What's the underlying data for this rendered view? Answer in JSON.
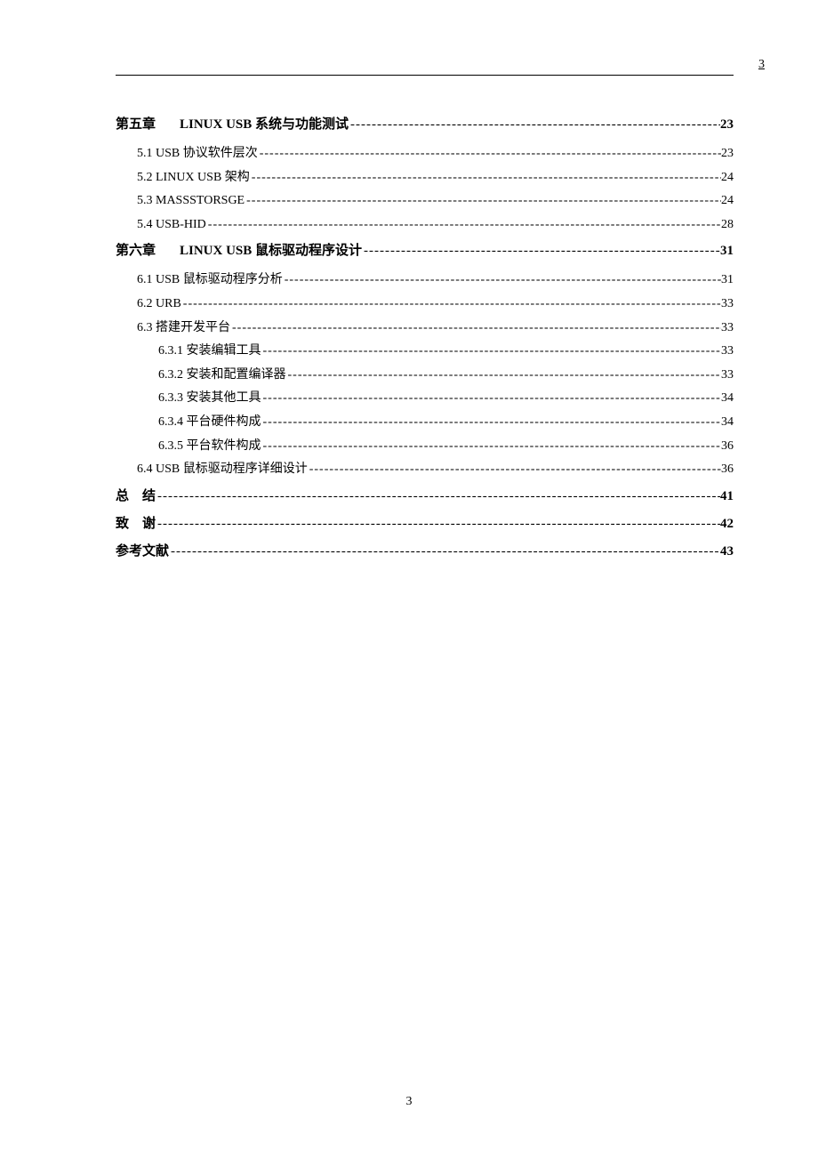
{
  "header": {
    "page_number_top": "3"
  },
  "footer": {
    "page_number_bottom": "3"
  },
  "leader_dots": "----------------------------------------------------------------------------------------------------------------------------------------------------------------------------------------------------",
  "toc": [
    {
      "type": "chapter",
      "num": "第五章",
      "title": "LINUX USB 系统与功能测试",
      "page": "23"
    },
    {
      "type": "sub",
      "title": "5.1 USB 协议软件层次",
      "page": "23"
    },
    {
      "type": "sub",
      "title": "5.2 LINUX USB 架构",
      "page": "24",
      "smallcaps": true
    },
    {
      "type": "sub",
      "title": "5.3 MASSSTORSGE",
      "page": "24",
      "smallcaps": true
    },
    {
      "type": "sub",
      "title": "5.4 USB-HID",
      "page": "28"
    },
    {
      "type": "chapter",
      "num": "第六章",
      "title": "LINUX USB 鼠标驱动程序设计",
      "page": "31"
    },
    {
      "type": "sub",
      "title": "6.1 USB 鼠标驱动程序分析",
      "page": "31"
    },
    {
      "type": "sub",
      "title": "6.2 URB",
      "page": "33"
    },
    {
      "type": "sub",
      "title": "6.3 搭建开发平台",
      "page": "33"
    },
    {
      "type": "subsub",
      "title": "6.3.1 安装编辑工具",
      "page": "33"
    },
    {
      "type": "subsub",
      "title": "6.3.2 安装和配置编译器",
      "page": "33"
    },
    {
      "type": "subsub",
      "title": "6.3.3 安装其他工具",
      "page": "34"
    },
    {
      "type": "subsub",
      "title": "6.3.4 平台硬件构成",
      "page": "34"
    },
    {
      "type": "subsub",
      "title": "6.3.5 平台软件构成",
      "page": "36"
    },
    {
      "type": "sub",
      "title": "6.4 USB 鼠标驱动程序详细设计",
      "page": "36"
    },
    {
      "type": "end",
      "title": "总　结",
      "page": "41"
    },
    {
      "type": "end",
      "title": "致　谢",
      "page": "42"
    },
    {
      "type": "end",
      "title": "参考文献",
      "page": "43"
    }
  ]
}
